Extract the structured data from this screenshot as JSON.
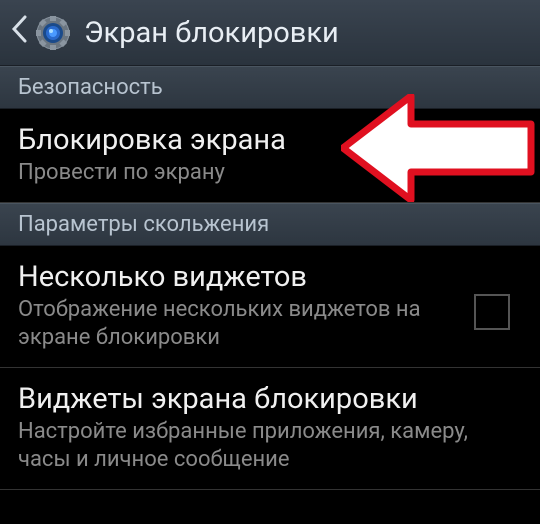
{
  "header": {
    "title": "Экран блокировки"
  },
  "sections": {
    "security": {
      "label": "Безопасность"
    },
    "slide_params": {
      "label": "Параметры скольжения"
    }
  },
  "items": {
    "screen_lock": {
      "title": "Блокировка экрана",
      "subtitle": "Провести по экрану"
    },
    "multiple_widgets": {
      "title": "Несколько виджетов",
      "subtitle": "Отображение нескольких виджетов на экране блокировки"
    },
    "lock_widgets": {
      "title": "Виджеты экрана блокировки",
      "subtitle": "Настройте избранные приложения, камеру, часы и личное сообщение"
    }
  }
}
